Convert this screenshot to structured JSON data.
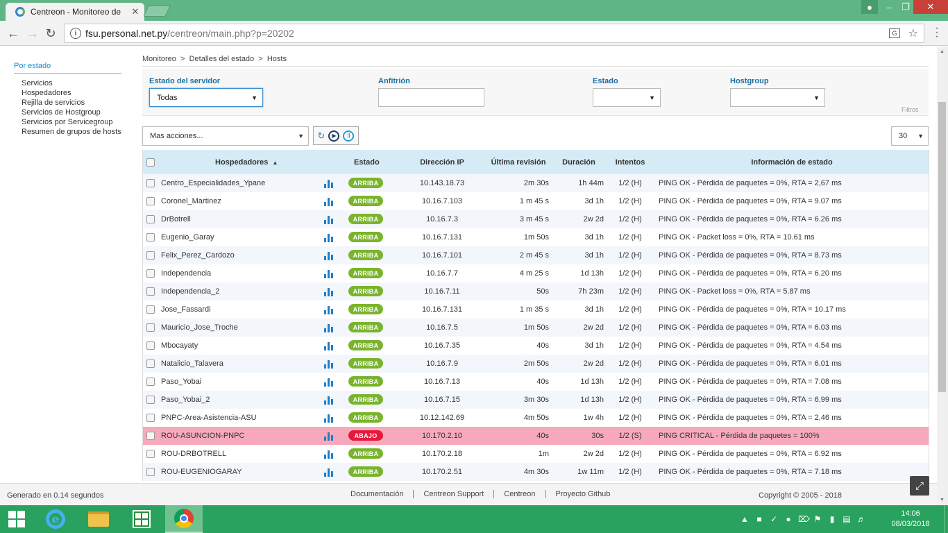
{
  "browser": {
    "tab_title": "Centreon - Monitoreo de",
    "tab_close": "✕",
    "url_host": "fsu.personal.net.py",
    "url_path": "/centreon/main.php?p=20202"
  },
  "sidebar": {
    "heading": "Por estado",
    "items": [
      {
        "label": "Servicios"
      },
      {
        "label": "Hospedadores"
      },
      {
        "label": "Rejilla de servicios"
      },
      {
        "label": "Servicios de Hostgroup"
      },
      {
        "label": "Servicios por Servicegroup"
      },
      {
        "label": "Resumen de grupos de hosts"
      }
    ]
  },
  "breadcrumb": {
    "items": [
      "Monitoreo",
      "Detalles del estado",
      "Hosts"
    ],
    "separator": ">"
  },
  "filters": {
    "server_state_label": "Estado del servidor",
    "server_state_value": "Todas",
    "host_label": "Anfitrión",
    "host_value": "",
    "state_label": "Estado",
    "state_value": "",
    "hostgroup_label": "Hostgroup",
    "hostgroup_value": "",
    "section_label": "Filtros"
  },
  "toolbar": {
    "actions_value": "Mas acciones...",
    "page_size": "30"
  },
  "table": {
    "headers": {
      "host": "Hospedadores",
      "host_sort": "▲",
      "status": "Estado",
      "ip": "Dirección IP",
      "last_check": "Última revisión",
      "duration": "Duración",
      "tries": "Intentos",
      "output": "Información de estado"
    },
    "rows": [
      {
        "host": "Centro_Especialidades_Ypane",
        "status": "ARRIBA",
        "ip": "10.143.18.73",
        "last_check": "2m 30s",
        "duration": "1h 44m",
        "tries": "1/2 (H)",
        "output": "PING OK - Pérdida de paquetes = 0%, RTA = 2,67 ms"
      },
      {
        "host": "Coronel_Martinez",
        "status": "ARRIBA",
        "ip": "10.16.7.103",
        "last_check": "1 m 45 s",
        "duration": "3d 1h",
        "tries": "1/2 (H)",
        "output": "PING OK - Pérdida de paquetes = 0%, RTA = 9.07 ms"
      },
      {
        "host": "DrBotrell",
        "status": "ARRIBA",
        "ip": "10.16.7.3",
        "last_check": "3 m 45 s",
        "duration": "2w 2d",
        "tries": "1/2 (H)",
        "output": "PING OK - Pérdida de paquetes = 0%, RTA = 6.26 ms"
      },
      {
        "host": "Eugenio_Garay",
        "status": "ARRIBA",
        "ip": "10.16.7.131",
        "last_check": "1m 50s",
        "duration": "3d 1h",
        "tries": "1/2 (H)",
        "output": "PING OK - Packet loss = 0%, RTA = 10.61 ms"
      },
      {
        "host": "Felix_Perez_Cardozo",
        "status": "ARRIBA",
        "ip": "10.16.7.101",
        "last_check": "2 m 45 s",
        "duration": "3d 1h",
        "tries": "1/2 (H)",
        "output": "PING OK - Pérdida de paquetes = 0%, RTA = 8.73 ms"
      },
      {
        "host": "Independencia",
        "status": "ARRIBA",
        "ip": "10.16.7.7",
        "last_check": "4 m 25 s",
        "duration": "1d 13h",
        "tries": "1/2 (H)",
        "output": "PING OK - Pérdida de paquetes = 0%, RTA = 6.20 ms"
      },
      {
        "host": "Independencia_2",
        "status": "ARRIBA",
        "ip": "10.16.7.11",
        "last_check": "50s",
        "duration": "7h 23m",
        "tries": "1/2 (H)",
        "output": "PING OK - Packet loss = 0%, RTA = 5.87 ms"
      },
      {
        "host": "Jose_Fassardi",
        "status": "ARRIBA",
        "ip": "10.16.7.131",
        "last_check": "1 m 35 s",
        "duration": "3d 1h",
        "tries": "1/2 (H)",
        "output": "PING OK - Pérdida de paquetes = 0%, RTA = 10.17 ms"
      },
      {
        "host": "Mauricio_Jose_Troche",
        "status": "ARRIBA",
        "ip": "10.16.7.5",
        "last_check": "1m 50s",
        "duration": "2w 2d",
        "tries": "1/2 (H)",
        "output": "PING OK - Pérdida de paquetes = 0%, RTA = 6.03 ms"
      },
      {
        "host": "Mbocayaty",
        "status": "ARRIBA",
        "ip": "10.16.7.35",
        "last_check": "40s",
        "duration": "3d 1h",
        "tries": "1/2 (H)",
        "output": "PING OK - Pérdida de paquetes = 0%, RTA = 4.54 ms"
      },
      {
        "host": "Natalicio_Talavera",
        "status": "ARRIBA",
        "ip": "10.16.7.9",
        "last_check": "2m 50s",
        "duration": "2w 2d",
        "tries": "1/2 (H)",
        "output": "PING OK - Pérdida de paquetes = 0%, RTA = 6.01 ms"
      },
      {
        "host": "Paso_Yobai",
        "status": "ARRIBA",
        "ip": "10.16.7.13",
        "last_check": "40s",
        "duration": "1d 13h",
        "tries": "1/2 (H)",
        "output": "PING OK - Pérdida de paquetes = 0%, RTA = 7.08 ms"
      },
      {
        "host": "Paso_Yobai_2",
        "status": "ARRIBA",
        "ip": "10.16.7.15",
        "last_check": "3m 30s",
        "duration": "1d 13h",
        "tries": "1/2 (H)",
        "output": "PING OK - Pérdida de paquetes = 0%, RTA = 6.99 ms"
      },
      {
        "host": "PNPC-Area-Asistencia-ASU",
        "status": "ARRIBA",
        "ip": "10.12.142.69",
        "last_check": "4m 50s",
        "duration": "1w 4h",
        "tries": "1/2 (H)",
        "output": "PING OK - Pérdida de paquetes = 0%, RTA = 2,46 ms"
      },
      {
        "host": "ROU-ASUNCION-PNPC",
        "status": "ABAJO",
        "ip": "10.170.2.10",
        "last_check": "40s",
        "duration": "30s",
        "tries": "1/2 (S)",
        "output": "PING CRITICAL - Pérdida de paquetes = 100%"
      },
      {
        "host": "ROU-DRBOTRELL",
        "status": "ARRIBA",
        "ip": "10.170.2.18",
        "last_check": "1m",
        "duration": "2w 2d",
        "tries": "1/2 (H)",
        "output": "PING OK - Pérdida de paquetes = 0%, RTA = 6.92 ms"
      },
      {
        "host": "ROU-EUGENIOGARAY",
        "status": "ARRIBA",
        "ip": "10.170.2.51",
        "last_check": "4m 30s",
        "duration": "1w 11m",
        "tries": "1/2 (H)",
        "output": "PING OK - Pérdida de paquetes = 0%, RTA = 7.18 ms"
      }
    ]
  },
  "footer": {
    "generated": "Generado en 0.14 segundos",
    "links": [
      "Documentación",
      "Centreon Support",
      "Centreon",
      "Proyecto Github"
    ],
    "copyright": "Copyright © 2005 - 2018"
  },
  "taskbar": {
    "time": "14:06",
    "date": "08/03/2018"
  },
  "colors": {
    "up": "#7ab42c",
    "down": "#e8183d",
    "down_row": "#f7a9bb",
    "header_bg": "#d5ecf7",
    "accent": "#1b8fc8"
  }
}
